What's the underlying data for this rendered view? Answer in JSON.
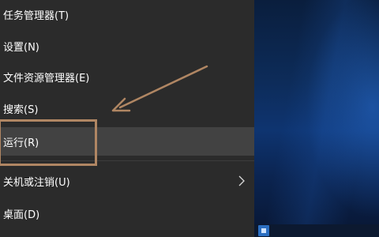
{
  "menu": {
    "items": [
      {
        "label": "任务管理器(T)"
      },
      {
        "label": "设置(N)"
      },
      {
        "label": "文件资源管理器(E)"
      },
      {
        "label": "搜索(S)"
      },
      {
        "label": "运行(R)"
      },
      {
        "label": "关机或注销(U)",
        "has_submenu": true
      },
      {
        "label": "桌面(D)"
      }
    ],
    "hovered_item": "运行(R)"
  },
  "icons": {
    "submenu": "chevron-right-icon",
    "tray": "taskbar-app-icon"
  },
  "colors": {
    "menu_background": "#2b2b2b",
    "menu_hover": "#424242",
    "annotation": "#b08663",
    "desktop": "#0e3470"
  }
}
